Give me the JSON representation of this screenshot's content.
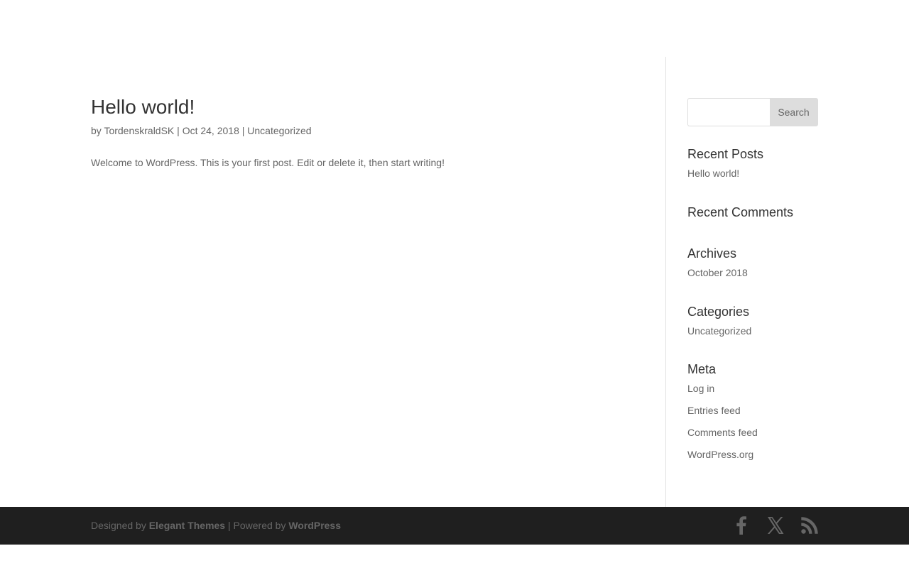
{
  "post": {
    "title": "Hello world!",
    "meta": {
      "by": "by ",
      "author": "TordenskraldSK",
      "sep1": " | ",
      "date": "Oct 24, 2018",
      "sep2": " | ",
      "category": "Uncategorized"
    },
    "content": "Welcome to WordPress. This is your first post. Edit or delete it, then start writing!"
  },
  "sidebar": {
    "search": {
      "value": "",
      "placeholder": "",
      "button_label": "Search"
    },
    "recent_posts": {
      "title": "Recent Posts",
      "items": [
        "Hello world!"
      ]
    },
    "recent_comments": {
      "title": "Recent Comments"
    },
    "archives": {
      "title": "Archives",
      "items": [
        "October 2018"
      ]
    },
    "categories": {
      "title": "Categories",
      "items": [
        "Uncategorized"
      ]
    },
    "meta": {
      "title": "Meta",
      "items": [
        "Log in",
        "Entries feed",
        "Comments feed",
        "WordPress.org"
      ]
    }
  },
  "footer": {
    "designed_by": "Designed by ",
    "theme_link": "Elegant Themes",
    "powered_sep": " | Powered by ",
    "wp_link": "WordPress",
    "social": {
      "facebook_icon": "facebook-icon",
      "x_icon": "x-icon",
      "rss_icon": "rss-icon"
    },
    "colors": {
      "background": "#1f1f1f",
      "text": "#666666"
    }
  }
}
